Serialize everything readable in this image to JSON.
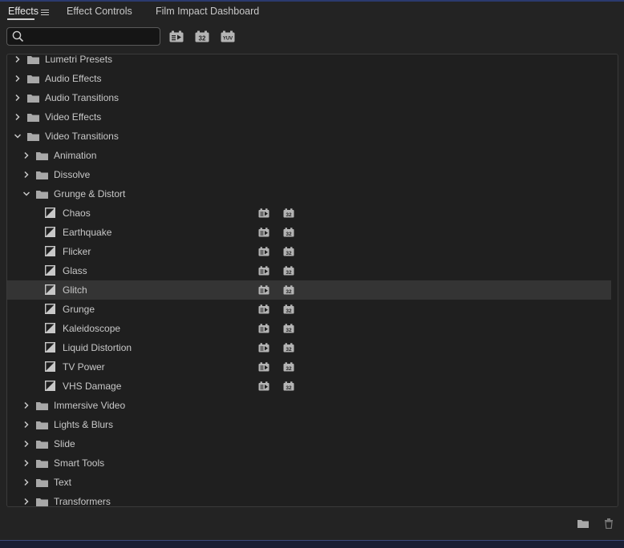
{
  "tabs": [
    {
      "label": "Effects"
    },
    {
      "label": "Effect Controls"
    },
    {
      "label": "Film Impact Dashboard"
    }
  ],
  "search": {
    "value": "",
    "placeholder": ""
  },
  "filters": [
    {
      "name": "accelerated-effects-filter-icon"
    },
    {
      "name": "32-bit-filter-icon",
      "text": "32"
    },
    {
      "name": "yuv-filter-icon",
      "text": "YUV"
    }
  ],
  "tree": [
    {
      "label": "Lumetri Presets",
      "type": "folder",
      "depth": 0,
      "expanded": false
    },
    {
      "label": "Audio Effects",
      "type": "folder",
      "depth": 0,
      "expanded": false
    },
    {
      "label": "Audio Transitions",
      "type": "folder",
      "depth": 0,
      "expanded": false
    },
    {
      "label": "Video Effects",
      "type": "folder",
      "depth": 0,
      "expanded": false
    },
    {
      "label": "Video Transitions",
      "type": "folder",
      "depth": 0,
      "expanded": true
    },
    {
      "label": "Animation",
      "type": "folder",
      "depth": 1,
      "expanded": false
    },
    {
      "label": "Dissolve",
      "type": "folder",
      "depth": 1,
      "expanded": false
    },
    {
      "label": "Grunge & Distort",
      "type": "folder",
      "depth": 1,
      "expanded": true
    },
    {
      "label": "Chaos",
      "type": "effect",
      "depth": 2
    },
    {
      "label": "Earthquake",
      "type": "effect",
      "depth": 2
    },
    {
      "label": "Flicker",
      "type": "effect",
      "depth": 2
    },
    {
      "label": "Glass",
      "type": "effect",
      "depth": 2
    },
    {
      "label": "Glitch",
      "type": "effect",
      "depth": 2,
      "selected": true
    },
    {
      "label": "Grunge",
      "type": "effect",
      "depth": 2
    },
    {
      "label": "Kaleidoscope",
      "type": "effect",
      "depth": 2
    },
    {
      "label": "Liquid Distortion",
      "type": "effect",
      "depth": 2
    },
    {
      "label": "TV Power",
      "type": "effect",
      "depth": 2
    },
    {
      "label": "VHS Damage",
      "type": "effect",
      "depth": 2
    },
    {
      "label": "Immersive Video",
      "type": "folder",
      "depth": 1,
      "expanded": false
    },
    {
      "label": "Lights & Blurs",
      "type": "folder",
      "depth": 1,
      "expanded": false
    },
    {
      "label": "Slide",
      "type": "folder",
      "depth": 1,
      "expanded": false
    },
    {
      "label": "Smart Tools",
      "type": "folder",
      "depth": 1,
      "expanded": false
    },
    {
      "label": "Text",
      "type": "folder",
      "depth": 1,
      "expanded": false
    },
    {
      "label": "Transformers",
      "type": "folder",
      "depth": 1,
      "expanded": false
    }
  ],
  "badges": {
    "accelerated": "accelerated-badge-icon",
    "bit32": "32"
  },
  "bottom_bar": {
    "new_bin_icon": "folder-icon",
    "delete_icon": "trash-icon"
  },
  "colors": {
    "background": "#232323",
    "panel": "#1f1f1f",
    "selected_row": "#343434",
    "text": "#c8c8c8"
  }
}
